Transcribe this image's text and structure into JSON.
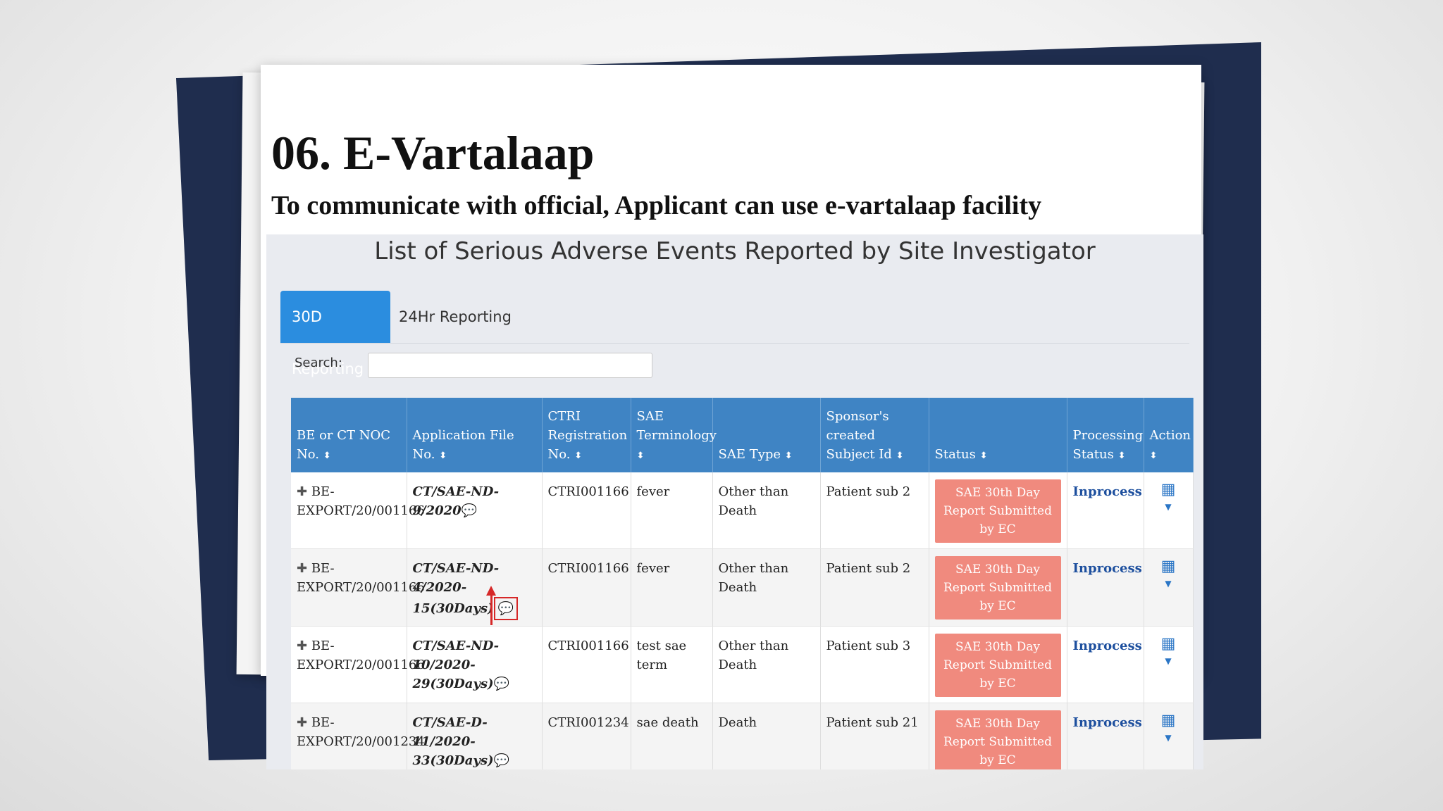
{
  "slide": {
    "title": "06. E-Vartalaap",
    "subtitle": "To communicate with official, Applicant can use e-vartalaap facility"
  },
  "page_title": "List of Serious Adverse Events Reported by Site Investigator",
  "tabs": [
    {
      "label": "30D Reporting",
      "active": true
    },
    {
      "label": "24Hr Reporting",
      "active": false
    }
  ],
  "search": {
    "label": "Search:",
    "value": ""
  },
  "table": {
    "sort_icon": "⬍",
    "headers": [
      "BE or CT NOC No.",
      "Application File No.",
      "CTRI Registration No.",
      "SAE Terminology",
      "SAE Type",
      "Sponsor's created Subject Id",
      "Status",
      "Processing Status",
      "Action"
    ],
    "rows": [
      {
        "noc_no": "BE-EXPORT/20/001166",
        "file_no": "CT/SAE-ND-9/2020",
        "ctri": "CTRI001166",
        "terminology": "fever",
        "sae_type": "Other than Death",
        "subject_id": "Patient sub 2",
        "status": "SAE 30th Day Report Submitted by EC",
        "processing": "Inprocess"
      },
      {
        "noc_no": "BE-EXPORT/20/001166",
        "file_no": "CT/SAE-ND-4/2020-15(30Days)",
        "ctri": "CTRI001166",
        "terminology": "fever",
        "sae_type": "Other than Death",
        "subject_id": "Patient sub 2",
        "status": "SAE 30th Day Report Submitted by EC",
        "processing": "Inprocess"
      },
      {
        "noc_no": "BE-EXPORT/20/001166",
        "file_no": "CT/SAE-ND-10/2020-29(30Days)",
        "ctri": "CTRI001166",
        "terminology": "test sae term",
        "sae_type": "Other than Death",
        "subject_id": "Patient sub 3",
        "status": "SAE 30th Day Report Submitted by EC",
        "processing": "Inprocess"
      },
      {
        "noc_no": "BE-EXPORT/20/001234",
        "file_no": "CT/SAE-D-11/2020-33(30Days)",
        "ctri": "CTRI001234",
        "terminology": "sae death",
        "sae_type": "Death",
        "subject_id": "Patient sub 21",
        "status": "SAE 30th Day Report Submitted by EC",
        "processing": "Inprocess"
      }
    ]
  },
  "icons": {
    "expand": "plus-icon",
    "chat": "chat-bubble-icon",
    "action": "grid-menu-icon",
    "caret": "caret-down-icon"
  },
  "colors": {
    "header_blue": "#3f84c4",
    "active_tab": "#2b8ddf",
    "status_badge": "#f08a7e",
    "highlight_red": "#d62828",
    "navy_sheet": "#1f2d4e"
  }
}
